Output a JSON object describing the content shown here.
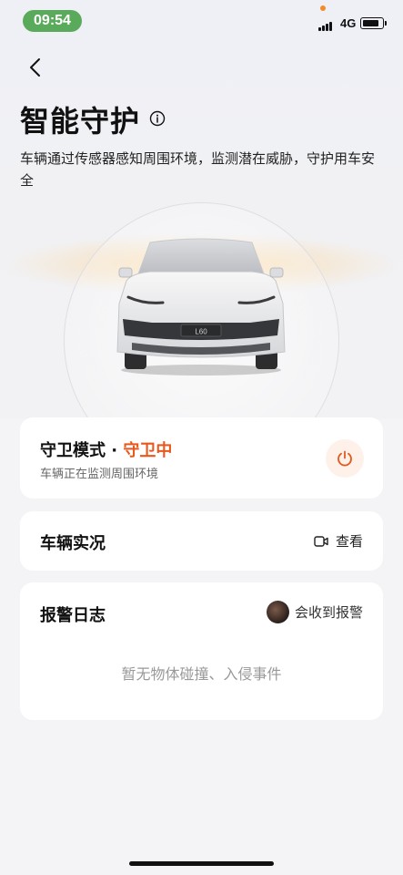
{
  "status_bar": {
    "time": "09:54",
    "network": "4G"
  },
  "page": {
    "title": "智能守护",
    "subtitle": "车辆通过传感器感知周围环境，监测潜在威胁，守护用车安全"
  },
  "car": {
    "plate": "L60"
  },
  "guard_card": {
    "title": "守卫模式",
    "separator": " · ",
    "status": "守卫中",
    "description": "车辆正在监测周围环境",
    "accent_color": "#e8581c"
  },
  "live_card": {
    "title": "车辆实况",
    "action_label": "查看"
  },
  "alarm_card": {
    "title": "报警日志",
    "receiver_label": "会收到报警",
    "empty_text": "暂无物体碰撞、入侵事件"
  },
  "icons": {
    "back": "chevron-left-icon",
    "info": "info-icon",
    "power": "power-icon",
    "camera": "camera-icon"
  }
}
